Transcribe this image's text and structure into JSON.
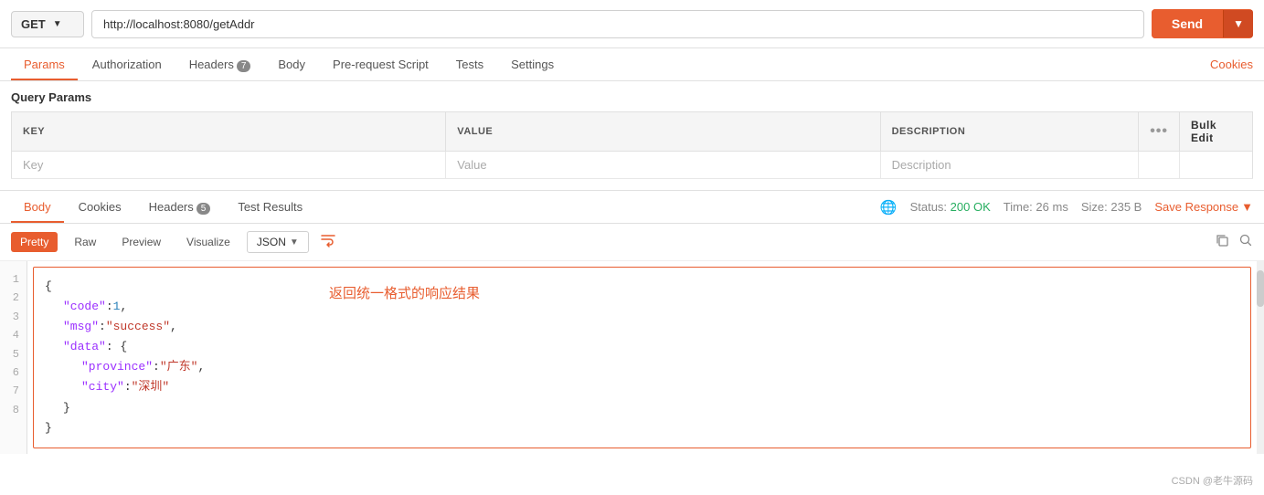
{
  "topbar": {
    "method": "GET",
    "chevron": "▼",
    "url": "http://localhost:8080/getAddr",
    "send_label": "Send",
    "send_arrow": "▼"
  },
  "request_tabs": {
    "tabs": [
      {
        "id": "params",
        "label": "Params",
        "badge": null,
        "active": true
      },
      {
        "id": "authorization",
        "label": "Authorization",
        "badge": null,
        "active": false
      },
      {
        "id": "headers",
        "label": "Headers",
        "badge": "7",
        "active": false
      },
      {
        "id": "body",
        "label": "Body",
        "badge": null,
        "active": false
      },
      {
        "id": "prerequest",
        "label": "Pre-request Script",
        "badge": null,
        "active": false
      },
      {
        "id": "tests",
        "label": "Tests",
        "badge": null,
        "active": false
      },
      {
        "id": "settings",
        "label": "Settings",
        "badge": null,
        "active": false
      }
    ],
    "cookies_link": "Cookies"
  },
  "query_params": {
    "title": "Query Params",
    "columns": [
      "KEY",
      "VALUE",
      "DESCRIPTION",
      "...",
      "Bulk Edit"
    ],
    "row_placeholders": [
      "Key",
      "Value",
      "Description"
    ]
  },
  "response_tabs": {
    "tabs": [
      {
        "id": "body",
        "label": "Body",
        "badge": null,
        "active": true
      },
      {
        "id": "cookies",
        "label": "Cookies",
        "badge": null,
        "active": false
      },
      {
        "id": "headers",
        "label": "Headers",
        "badge": "5",
        "active": false
      },
      {
        "id": "test-results",
        "label": "Test Results",
        "badge": null,
        "active": false
      }
    ],
    "status_label": "Status:",
    "status_value": "200 OK",
    "time_label": "Time:",
    "time_value": "26 ms",
    "size_label": "Size:",
    "size_value": "235 B",
    "save_response": "Save Response",
    "save_arrow": "▼"
  },
  "response_format": {
    "formats": [
      "Pretty",
      "Raw",
      "Preview",
      "Visualize"
    ],
    "active_format": "Pretty",
    "type_options": [
      "JSON"
    ],
    "selected_type": "JSON",
    "wrap_icon": "⇌",
    "copy_icon": "⧉",
    "search_icon": "🔍"
  },
  "response_body": {
    "lines": [
      "1",
      "2",
      "3",
      "4",
      "5",
      "6",
      "7",
      "8"
    ],
    "annotation": "返回统一格式的响应结果",
    "code": [
      {
        "indent": 0,
        "content": "{"
      },
      {
        "indent": 1,
        "content": "\"code\": 1,"
      },
      {
        "indent": 1,
        "content": "\"msg\": \"success\","
      },
      {
        "indent": 1,
        "content": "\"data\": {"
      },
      {
        "indent": 2,
        "content": "\"province\": \"广东\","
      },
      {
        "indent": 2,
        "content": "\"city\": \"深圳\""
      },
      {
        "indent": 1,
        "content": "}"
      },
      {
        "indent": 0,
        "content": "}"
      }
    ]
  },
  "watermark": "CSDN @老牛源码"
}
